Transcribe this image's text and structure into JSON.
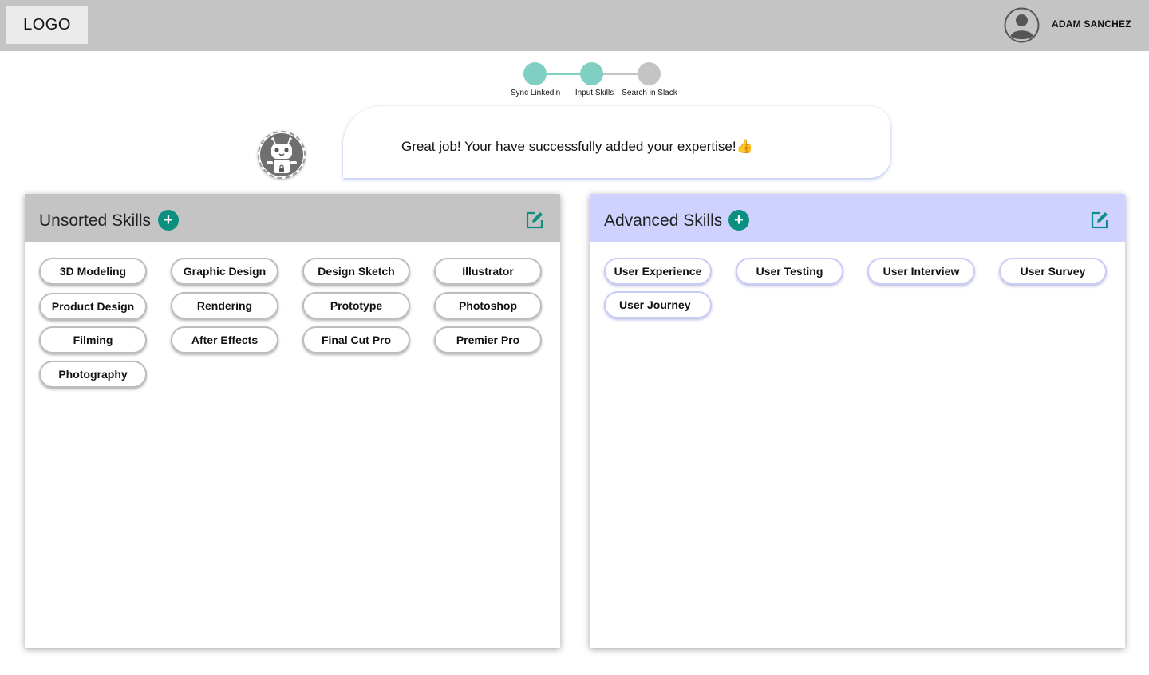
{
  "header": {
    "logo": "LOGO",
    "username": "ADAM SANCHEZ"
  },
  "stepper": {
    "steps": [
      {
        "label": "Sync Linkedin",
        "status": "complete"
      },
      {
        "label": "Input Skills",
        "status": "current"
      },
      {
        "label": "Search in Slack",
        "status": "pending"
      }
    ],
    "colors": {
      "complete": "#7fcfc3",
      "pending": "#c4c4c4"
    }
  },
  "bot": {
    "message": "Great job! Your have successfully added your expertise!👍"
  },
  "panels": {
    "unsorted": {
      "title": "Unsorted Skills",
      "header_color": "#c4c4c4",
      "skills": [
        "3D Modeling",
        "Graphic Design",
        "Design Sketch",
        "Illustrator",
        "Product Design",
        "Rendering",
        "Prototype",
        "Photoshop",
        "Filming",
        "After Effects",
        "Final Cut Pro",
        "Premier Pro",
        "Photography"
      ]
    },
    "advanced": {
      "title": "Advanced Skills",
      "header_color": "#cfd2ff",
      "skills": [
        "User Experience",
        "User Testing",
        "User Interview",
        "User Survey",
        "User Journey"
      ]
    }
  },
  "accent_color": "#0b8f7f"
}
